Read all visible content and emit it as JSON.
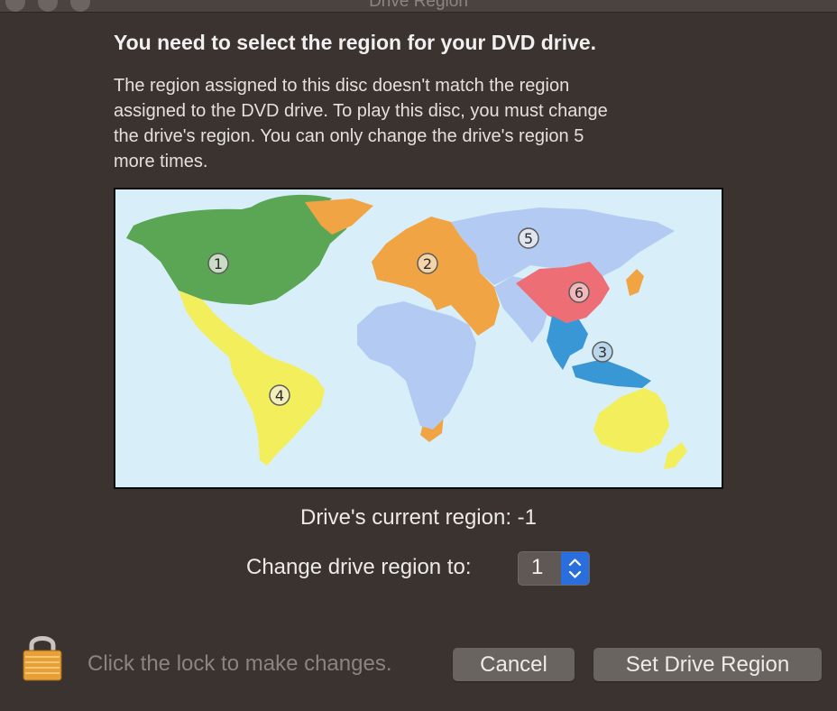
{
  "window": {
    "title": "Drive Region"
  },
  "dialog": {
    "heading": "You need to select the region for your DVD drive.",
    "description": "The region assigned to this disc doesn't match the region\nassigned to the DVD drive. To play this disc, you must change\nthe drive's region. You can only change the drive's region 5\nmore times."
  },
  "map": {
    "region_labels": [
      "1",
      "2",
      "3",
      "4",
      "5",
      "6"
    ],
    "region_colors": {
      "1": "#5aa654",
      "2": "#f0a443",
      "3": "#3a97d6",
      "4": "#f3ee5c",
      "5": "#b3cbf2",
      "6": "#ee6e76"
    },
    "ocean_color": "#d8eff9"
  },
  "current_region": {
    "text": "Drive's current region: -1"
  },
  "change_region": {
    "label": "Change drive region to:",
    "value": "1"
  },
  "footer": {
    "lock_text": "Click the lock to make changes.",
    "cancel_label": "Cancel",
    "set_label": "Set Drive Region"
  },
  "icons": {
    "lock": "lock-icon",
    "stepper": "up-down-chevron-icon"
  }
}
